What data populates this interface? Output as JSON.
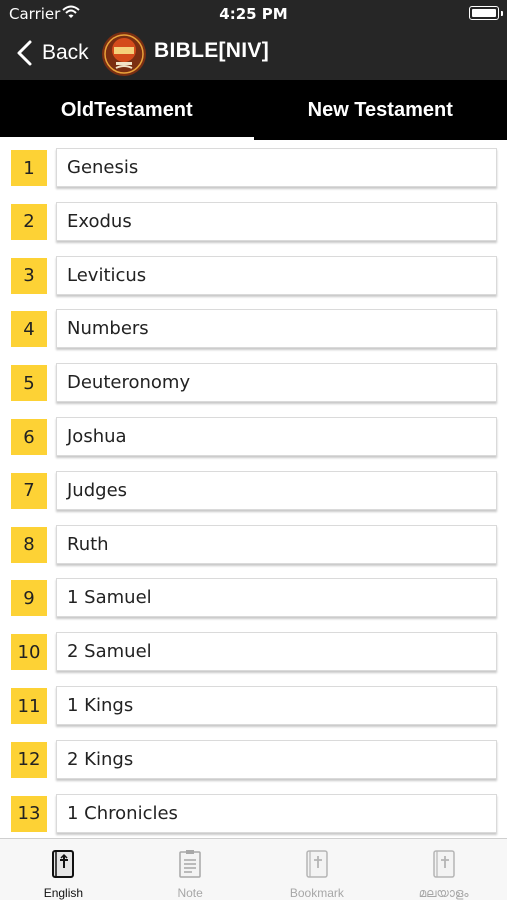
{
  "status_bar": {
    "carrier": "Carrier",
    "time": "4:25 PM"
  },
  "navbar": {
    "back_label": "Back",
    "title": "BIBLE[NIV]"
  },
  "tabs": [
    {
      "label": "OldTestament",
      "active": true
    },
    {
      "label": "New Testament",
      "active": false
    }
  ],
  "books": [
    {
      "number": "1",
      "name": "Genesis"
    },
    {
      "number": "2",
      "name": "Exodus"
    },
    {
      "number": "3",
      "name": "Leviticus"
    },
    {
      "number": "4",
      "name": "Numbers"
    },
    {
      "number": "5",
      "name": "Deuteronomy"
    },
    {
      "number": "6",
      "name": "Joshua"
    },
    {
      "number": "7",
      "name": "Judges"
    },
    {
      "number": "8",
      "name": "Ruth"
    },
    {
      "number": "9",
      "name": "1 Samuel"
    },
    {
      "number": "10",
      "name": "2 Samuel"
    },
    {
      "number": "11",
      "name": "1 Kings"
    },
    {
      "number": "12",
      "name": "2 Kings"
    },
    {
      "number": "13",
      "name": "1 Chronicles"
    }
  ],
  "bottom_tabs": [
    {
      "label": "English",
      "icon": "bible-book-icon",
      "active": true
    },
    {
      "label": "Note",
      "icon": "note-icon",
      "active": false
    },
    {
      "label": "Bookmark",
      "icon": "bookmark-book-icon",
      "active": false
    },
    {
      "label": "മലയാളം",
      "icon": "bible-book-icon",
      "active": false
    }
  ],
  "colors": {
    "header": "#262626",
    "tab_bar": "#000000",
    "number_badge": "#fdd235",
    "active_tab_label": "#111111",
    "inactive_tab_label": "#a7a7a7"
  }
}
